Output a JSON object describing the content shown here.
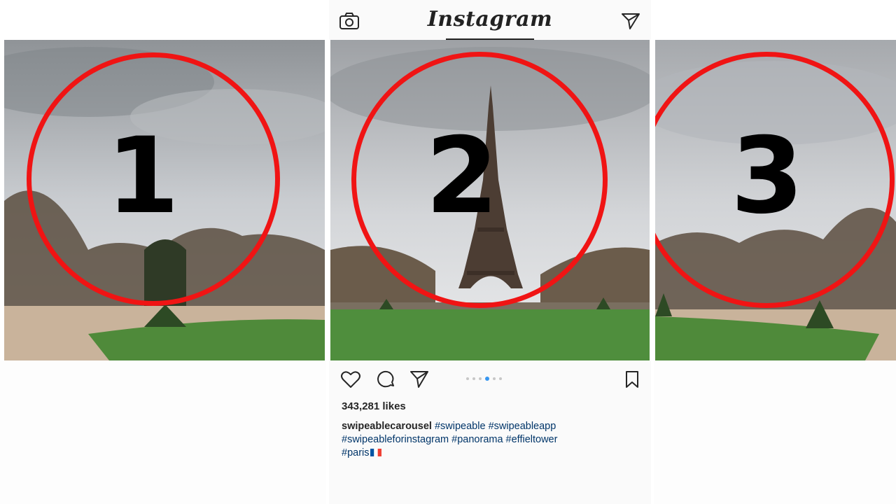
{
  "app": {
    "logo_text": "Instagram"
  },
  "header": {
    "camera_icon": "camera-icon",
    "direct_icon": "paper-plane-icon"
  },
  "carousel": {
    "panels": [
      {
        "number": "1"
      },
      {
        "number": "2"
      },
      {
        "number": "3"
      }
    ],
    "circle_color": "#f01414",
    "page_indicator": {
      "total": 6,
      "active_index": 3
    }
  },
  "post": {
    "likes": "343,281 likes",
    "username": "swipeablecarousel",
    "caption_lines": [
      "#swipeable #swipeableapp",
      "#swipeableforinstagram #panorama #effieltower",
      "#paris"
    ],
    "accent_color": "#3897f0"
  },
  "icons": [
    "heart-icon",
    "comment-icon",
    "share-icon",
    "bookmark-icon"
  ]
}
